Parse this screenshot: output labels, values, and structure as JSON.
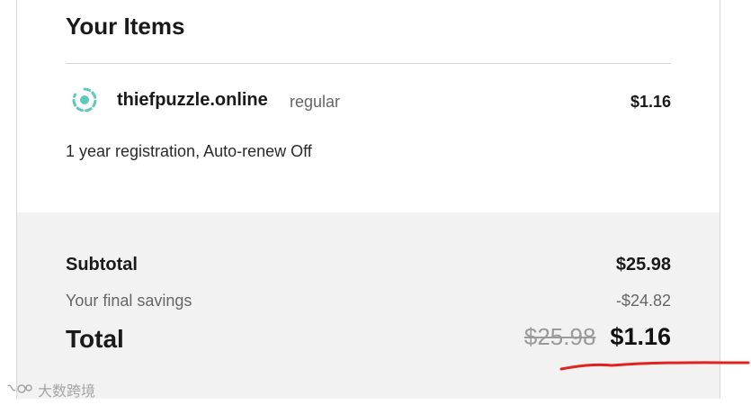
{
  "items_section": {
    "title": "Your Items"
  },
  "item": {
    "icon": "domain-item-icon",
    "domain": "thiefpuzzle.online",
    "tier": "regular",
    "price": "$1.16",
    "registration": "1 year registration, Auto-renew Off"
  },
  "summary": {
    "subtotal_label": "Subtotal",
    "subtotal_value": "$25.98",
    "savings_label": "Your final savings",
    "savings_value": "-$24.82",
    "total_label": "Total",
    "original_price": "$25.98",
    "final_price": "$1.16"
  },
  "watermark": {
    "text": "大数跨境"
  },
  "colors": {
    "accent_teal": "#5ec9b8",
    "summary_bg": "#f2f2f2",
    "annotation_red": "#e0231f"
  }
}
